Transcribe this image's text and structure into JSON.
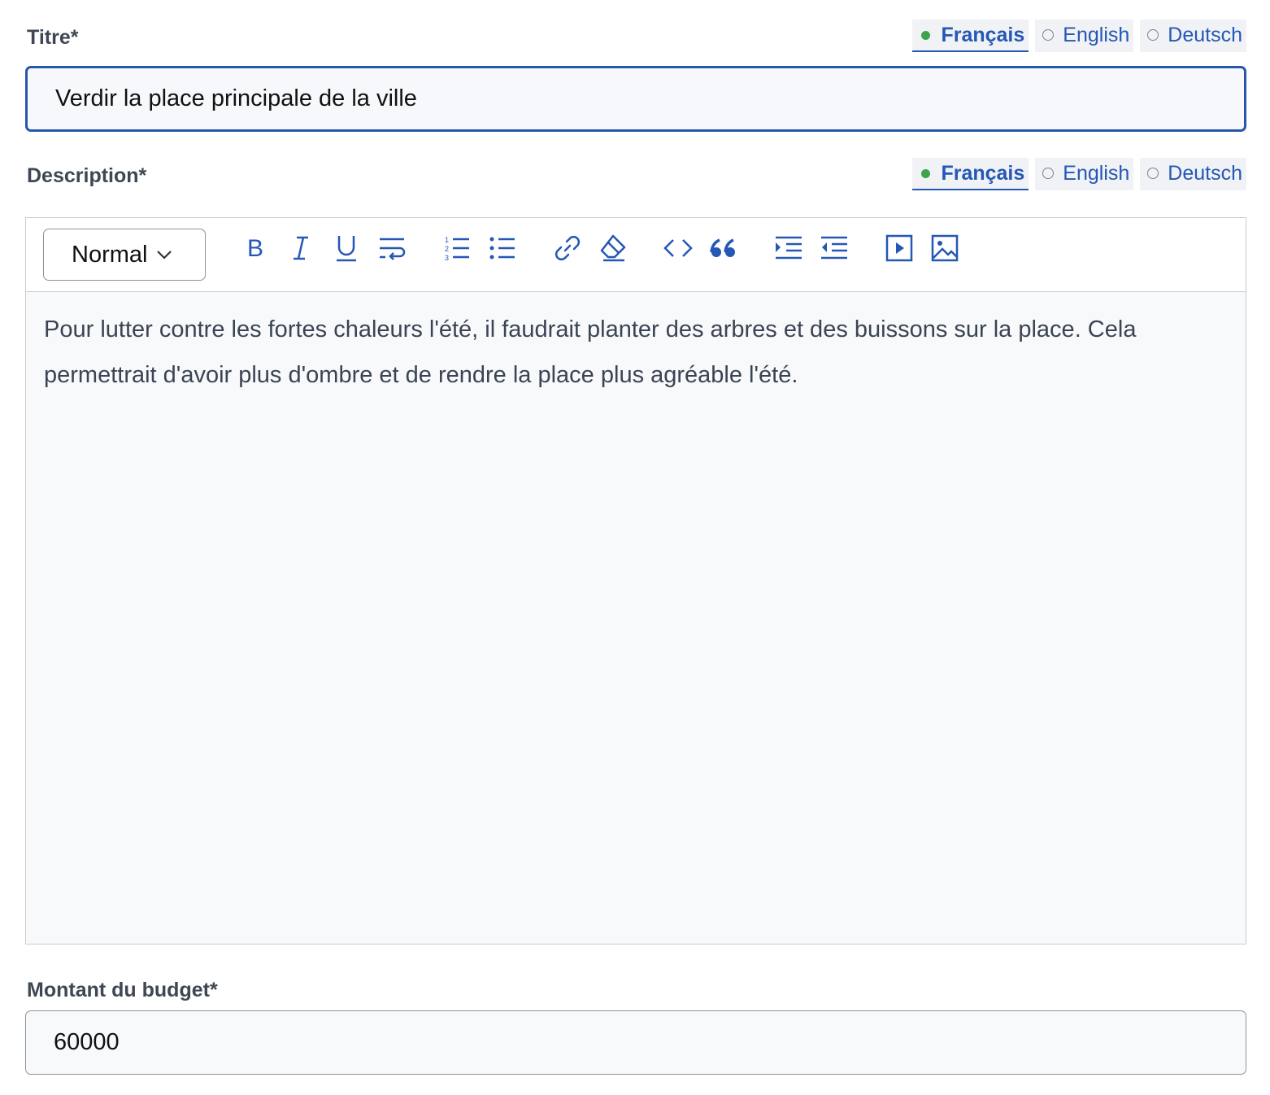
{
  "title_field": {
    "label": "Titre*",
    "value": "Verdir la place principale de la ville",
    "languages": [
      {
        "label": "Français",
        "active": true
      },
      {
        "label": "English",
        "active": false
      },
      {
        "label": "Deutsch",
        "active": false
      }
    ]
  },
  "description_field": {
    "label": "Description*",
    "languages": [
      {
        "label": "Français",
        "active": true
      },
      {
        "label": "English",
        "active": false
      },
      {
        "label": "Deutsch",
        "active": false
      }
    ],
    "format_select": "Normal",
    "toolbar_icons": [
      "bold-icon",
      "italic-icon",
      "underline-icon",
      "text-wrap-icon",
      "ordered-list-icon",
      "bullet-list-icon",
      "link-icon",
      "clear-format-icon",
      "code-icon",
      "quote-icon",
      "indent-icon",
      "outdent-icon",
      "video-icon",
      "image-icon"
    ],
    "body": "Pour lutter contre les fortes chaleurs l'été, il faudrait planter des arbres et des buissons sur la place. Cela permettrait d'avoir plus d'ombre et de rendre la place plus agréable l'été."
  },
  "budget_field": {
    "label": "Montant du budget*",
    "value": "60000"
  },
  "colors": {
    "accent": "#2557b5",
    "active_dot": "#3fa34d",
    "focus_border": "#2a56a8"
  }
}
